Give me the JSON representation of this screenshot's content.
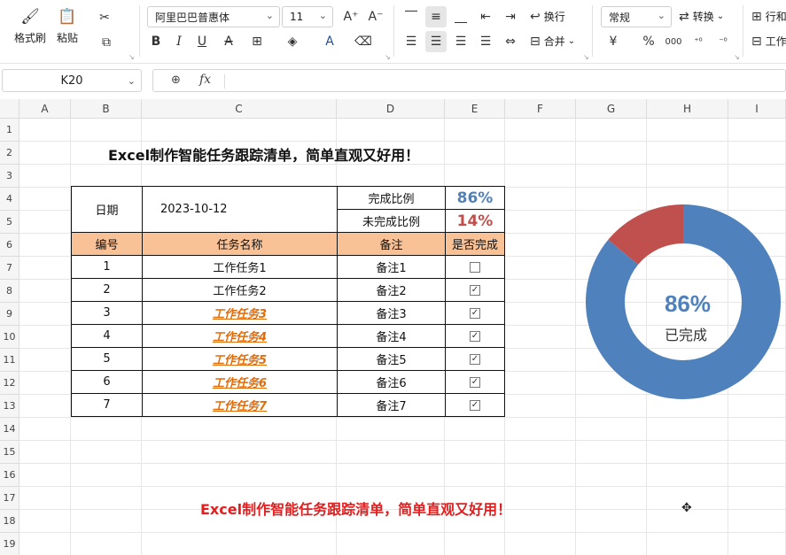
{
  "ribbon": {
    "format_painter": "格式刷",
    "paste": "粘贴",
    "font_name": "阿里巴巴普惠体",
    "font_size": "11",
    "bold": "B",
    "italic": "I",
    "underline": "U",
    "strike": "A",
    "font_color": "A",
    "wrap": "换行",
    "merge": "合并",
    "number_format": "常规",
    "convert": "转换",
    "percent": "%",
    "rows_cols": "行和",
    "worksheet": "工作",
    "currency": "¥"
  },
  "formula_bar": {
    "name_box": "K20",
    "fx": "fx",
    "value": ""
  },
  "columns": [
    "A",
    "B",
    "C",
    "D",
    "E",
    "F",
    "G",
    "H",
    "I"
  ],
  "rows": [
    "1",
    "2",
    "3",
    "4",
    "5",
    "6",
    "7",
    "8",
    "9",
    "10",
    "11",
    "12",
    "13",
    "14",
    "15",
    "16",
    "17",
    "18",
    "19"
  ],
  "sheet": {
    "title_top": "Excel制作智能任务跟踪清单，简单直观又好用！",
    "title_bottom": "Excel制作智能任务跟踪清单，简单直观又好用！",
    "date_label": "日期",
    "date_value": "2023-10-12",
    "done_ratio_label": "完成比例",
    "done_ratio_value": "86%",
    "undone_ratio_label": "未完成比例",
    "undone_ratio_value": "14%",
    "headers": [
      "编号",
      "任务名称",
      "备注",
      "是否完成"
    ],
    "tasks": [
      {
        "no": "1",
        "name": "工作任务1",
        "note": "备注1",
        "done": false
      },
      {
        "no": "2",
        "name": "工作任务2",
        "note": "备注2",
        "done": true
      },
      {
        "no": "3",
        "name": "工作任务3",
        "note": "备注3",
        "done": true
      },
      {
        "no": "4",
        "name": "工作任务4",
        "note": "备注4",
        "done": true
      },
      {
        "no": "5",
        "name": "工作任务5",
        "note": "备注5",
        "done": true
      },
      {
        "no": "6",
        "name": "工作任务6",
        "note": "备注6",
        "done": true
      },
      {
        "no": "7",
        "name": "工作任务7",
        "note": "备注7",
        "done": true
      }
    ]
  },
  "chart_data": {
    "type": "pie",
    "style": "donut",
    "categories": [
      "完成比例",
      "未完成比例"
    ],
    "values": [
      86,
      14
    ],
    "colors": [
      "#4f81bd",
      "#c0504d"
    ],
    "center_value": "86%",
    "center_label": "已完成"
  },
  "colors": {
    "header_fill": "#f8c196",
    "done_task_text": "#e36c09",
    "done_pct": "#4f81bd",
    "undone_pct": "#c0504d",
    "title_red": "#e02020"
  }
}
